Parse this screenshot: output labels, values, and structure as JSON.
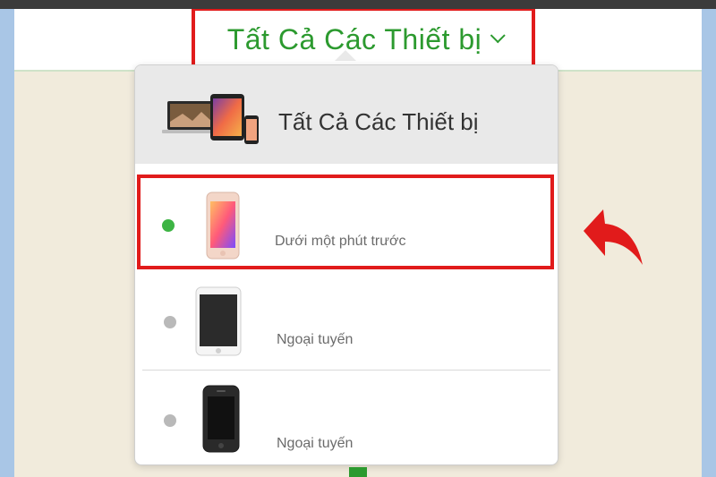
{
  "header": {
    "title": "Tất Cả Các Thiết bị"
  },
  "dropdown": {
    "all_label": "Tất Cả Các Thiết bị",
    "rows": [
      {
        "status": "Dưới một phút trước",
        "state": "online"
      },
      {
        "status": "Ngoại tuyến",
        "state": "offline"
      },
      {
        "status": "Ngoại tuyến",
        "state": "offline"
      }
    ]
  },
  "colors": {
    "accent_green": "#2c9a2f",
    "highlight_red": "#e11b1b",
    "online_dot": "#3db444",
    "offline_dot": "#b9b9b9"
  }
}
